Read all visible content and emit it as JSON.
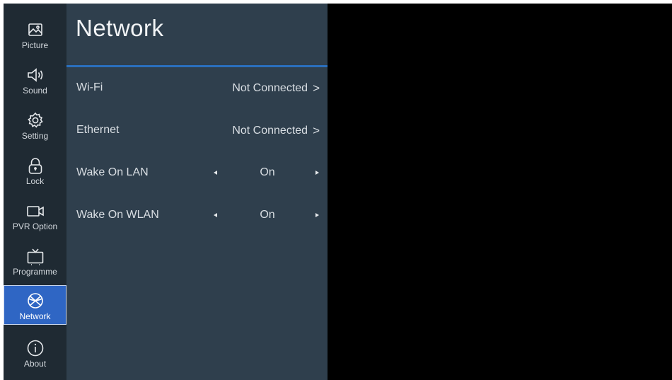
{
  "sidebar": {
    "items": [
      {
        "label": "Picture",
        "icon": "picture-icon"
      },
      {
        "label": "Sound",
        "icon": "speaker-icon"
      },
      {
        "label": "Setting",
        "icon": "gear-icon"
      },
      {
        "label": "Lock",
        "icon": "lock-icon"
      },
      {
        "label": "PVR Option",
        "icon": "video-camera-icon"
      },
      {
        "label": "Programme",
        "icon": "tv-icon"
      },
      {
        "label": "Network",
        "icon": "globe-icon",
        "active": true
      },
      {
        "label": "About",
        "icon": "info-icon"
      }
    ]
  },
  "panel": {
    "title": "Network",
    "rows": [
      {
        "label": "Wi-Fi",
        "value": "Not Connected",
        "type": "link"
      },
      {
        "label": "Ethernet",
        "value": "Not Connected",
        "type": "link"
      },
      {
        "label": "Wake On LAN",
        "value": "On",
        "type": "selector"
      },
      {
        "label": "Wake On WLAN",
        "value": "On",
        "type": "selector"
      }
    ],
    "chevron": ">"
  },
  "colors": {
    "sidebar_bg": "#1f2a33",
    "panel_bg": "#2f3f4d",
    "accent": "#2f66c4",
    "divider": "#2a6fbd"
  }
}
